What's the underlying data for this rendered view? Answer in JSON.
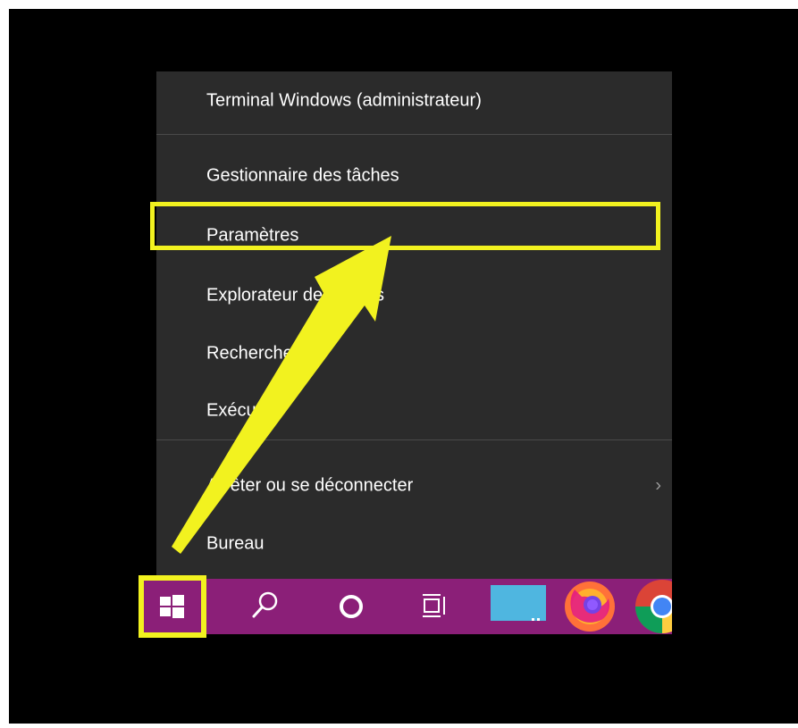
{
  "context_menu": {
    "items": [
      {
        "label": "Terminal Windows (administrateur)"
      },
      {
        "label": "Gestionnaire des tâches"
      },
      {
        "label": "Paramètres"
      },
      {
        "label": "Explorateur de fichiers"
      },
      {
        "label": "Recherche"
      },
      {
        "label": "Exécuter"
      },
      {
        "label": "Arrêter ou se déconnecter",
        "submenu_indicator": "›"
      },
      {
        "label": "Bureau"
      }
    ]
  },
  "taskbar": {
    "color": "#8b1f78",
    "items": [
      {
        "icon": "windows-start-icon"
      },
      {
        "icon": "search-icon"
      },
      {
        "icon": "cortana-icon"
      },
      {
        "icon": "task-view-icon"
      },
      {
        "icon": "app-window-icon"
      },
      {
        "icon": "firefox-icon"
      },
      {
        "icon": "chrome-icon"
      }
    ]
  },
  "annotation": {
    "highlight_color": "#f2f21f"
  }
}
